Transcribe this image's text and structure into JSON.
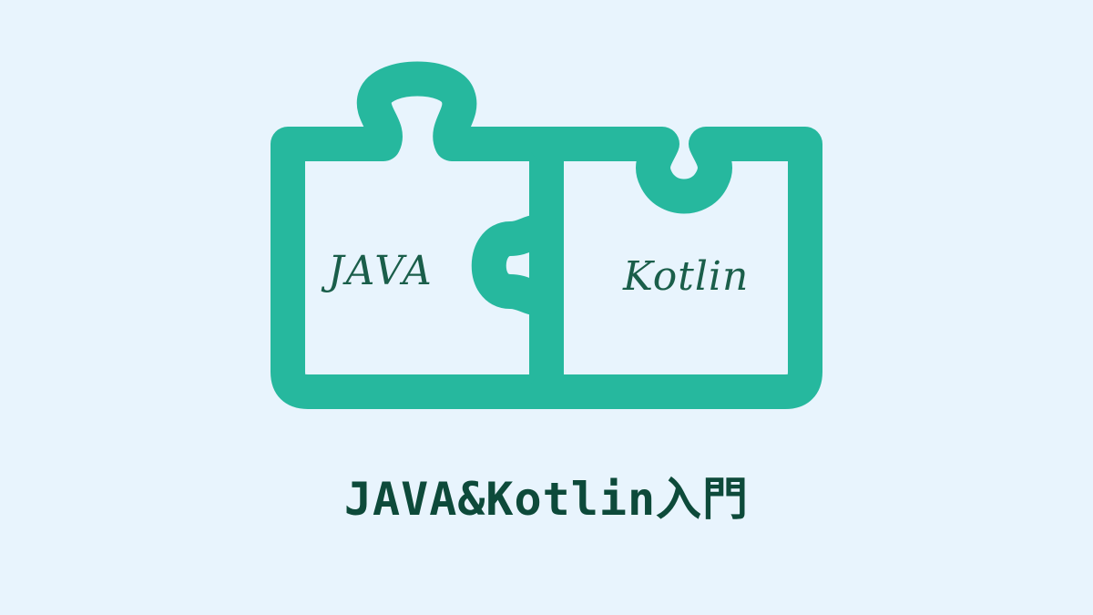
{
  "colors": {
    "background": "#e8f4fd",
    "puzzle_outline": "#26b89e",
    "label_text": "#1a5e4a",
    "title_text": "#0d4a3a"
  },
  "puzzle": {
    "left_piece_label": "JAVA",
    "right_piece_label": "Kotlin"
  },
  "title": "JAVA&Kotlin入門"
}
